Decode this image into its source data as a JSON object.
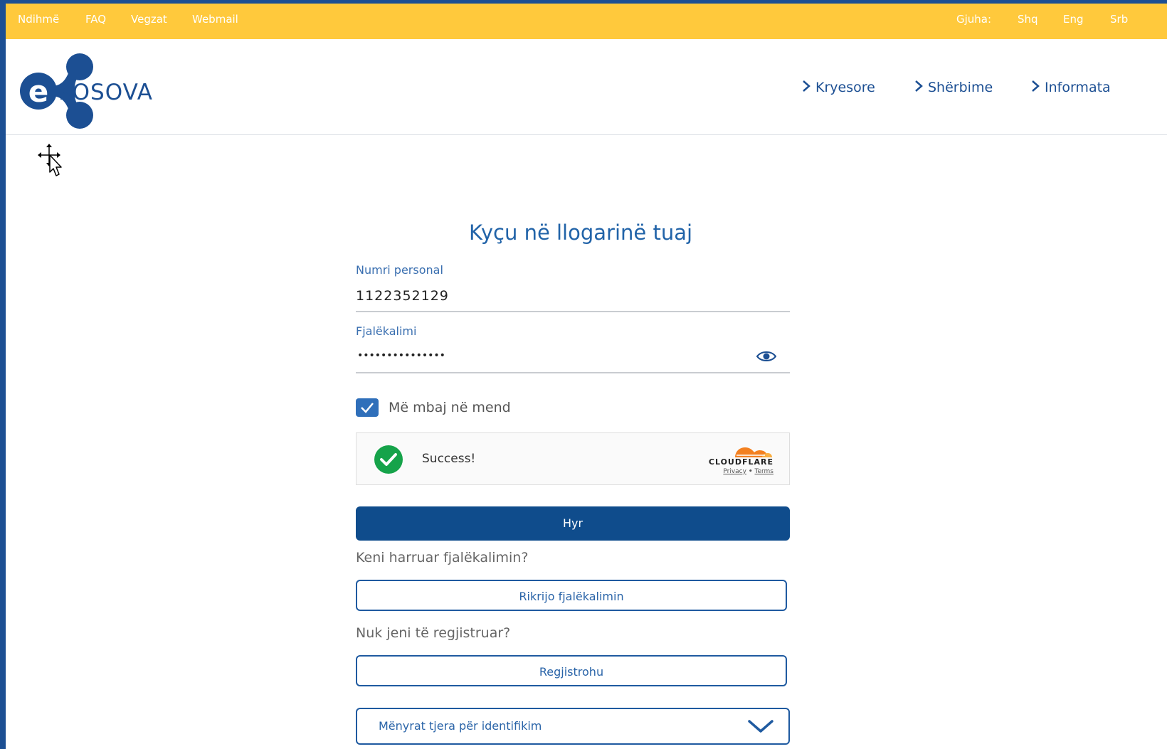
{
  "topbar": {
    "links": [
      "Ndihmë",
      "FAQ",
      "Vegzat",
      "Webmail"
    ],
    "language_label": "Gjuha:",
    "languages": [
      "Shq",
      "Eng",
      "Srb"
    ]
  },
  "header": {
    "logo_letter": "e",
    "logo_text": "KOSOVA",
    "nav": [
      "Kryesore",
      "Shërbime",
      "Informata"
    ]
  },
  "login": {
    "title": "Kyçu në llogarinë tuaj",
    "personal_number_label": "Numri personal",
    "personal_number_value": "1122352129",
    "password_label": "Fjalëkalimi",
    "password_value": "•••••••••••••••",
    "remember_label": "Më mbaj në mend",
    "remember_checked": true,
    "submit_label": "Hyr",
    "forgot_prompt": "Keni harruar fjalëkalimin?",
    "reset_label": "Rikrijo fjalëkalimin",
    "register_prompt": "Nuk jeni të regjistruar?",
    "register_label": "Regjistrohu",
    "other_methods_label": "Mënyrat tjera për identifikim"
  },
  "captcha": {
    "status": "Success!",
    "provider": "CLOUDFLARE",
    "privacy_link": "Privacy",
    "separator": "•",
    "terms_link": "Terms"
  },
  "colors": {
    "topbar": "#ffc93c",
    "primary": "#0f4c8c",
    "link": "#1c4f93",
    "success": "#16a34a",
    "cloudflare": "#f38020"
  }
}
